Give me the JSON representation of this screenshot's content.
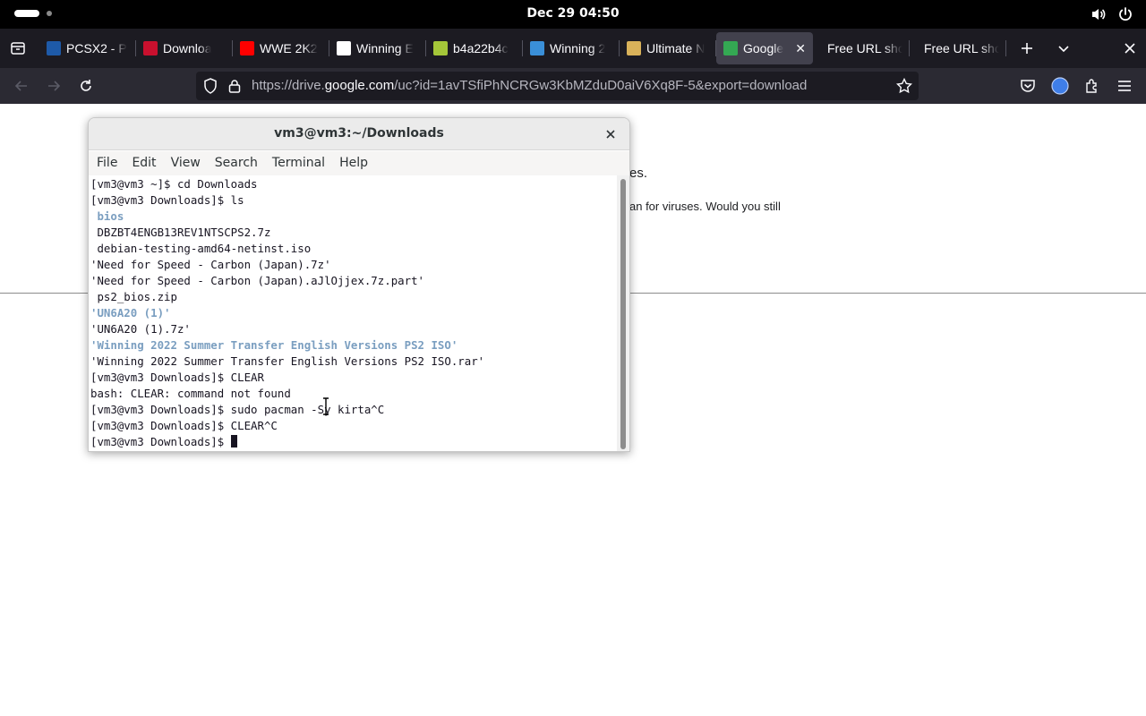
{
  "topbar": {
    "clock": "Dec 29  04:50",
    "icons": [
      "workspace-indicator-icon",
      "volume-icon",
      "power-icon"
    ]
  },
  "browser": {
    "tabs": [
      {
        "title": "PCSX2 - P",
        "favicon": "pcsx2-icon",
        "favicon_color": "#1e5aa8"
      },
      {
        "title": "Downloa",
        "favicon": "download-site-icon",
        "favicon_color": "#c8102e"
      },
      {
        "title": "WWE 2K2",
        "favicon": "youtube-icon",
        "favicon_color": "#ff0000"
      },
      {
        "title": "Winning E",
        "favicon": "winning-icon",
        "favicon_color": "#ffffff"
      },
      {
        "title": "b4a22b4c",
        "favicon": "android-icon",
        "favicon_color": "#a4c639"
      },
      {
        "title": "Winning 2",
        "favicon": "site-icon",
        "favicon_color": "#3a8fd8"
      },
      {
        "title": "Ultimate N",
        "favicon": "ultimate-icon",
        "favicon_color": "#d9b25a"
      },
      {
        "title": "Google",
        "favicon": "google-drive-icon",
        "favicon_color": "#34a853",
        "active": true
      },
      {
        "title": "Free URL sho",
        "favicon": ""
      },
      {
        "title": "Free URL sho",
        "favicon": ""
      }
    ],
    "url_prefix": "https://drive.",
    "url_domain": "google.com",
    "url_suffix": "/uc?id=1avTSfiPhNCRGw3KbMZduD0aiV6Xq8F-5&export=download"
  },
  "page": {
    "fragment_1": "es.",
    "fragment_2": "an for viruses. Would you still"
  },
  "terminal": {
    "title": "vm3@vm3:~/Downloads",
    "menu": [
      "File",
      "Edit",
      "View",
      "Search",
      "Terminal",
      "Help"
    ],
    "lines": [
      {
        "text": "[vm3@vm3 ~]$ cd Downloads",
        "kind": "plain"
      },
      {
        "text": "[vm3@vm3 Downloads]$ ls",
        "kind": "plain"
      },
      {
        "text": " bios",
        "kind": "dir"
      },
      {
        "text": " DBZBT4ENGB13REV1NTSCPS2.7z",
        "kind": "plain"
      },
      {
        "text": " debian-testing-amd64-netinst.iso",
        "kind": "plain"
      },
      {
        "text": "'Need for Speed - Carbon (Japan).7z'",
        "kind": "plain"
      },
      {
        "text": "'Need for Speed - Carbon (Japan).aJlOjjex.7z.part'",
        "kind": "plain"
      },
      {
        "text": " ps2_bios.zip",
        "kind": "plain"
      },
      {
        "text": "'UN6A20 (1)'",
        "kind": "dir"
      },
      {
        "text": "'UN6A20 (1).7z'",
        "kind": "plain"
      },
      {
        "text": "'Winning 2022 Summer Transfer English Versions PS2 ISO'",
        "kind": "dir"
      },
      {
        "text": "'Winning 2022 Summer Transfer English Versions PS2 ISO.rar'",
        "kind": "plain"
      },
      {
        "text": "[vm3@vm3 Downloads]$ CLEAR",
        "kind": "plain"
      },
      {
        "text": "bash: CLEAR: command not found",
        "kind": "plain"
      },
      {
        "text": "[vm3@vm3 Downloads]$ sudo pacman -Sy kirta^C",
        "kind": "plain"
      },
      {
        "text": "[vm3@vm3 Downloads]$ CLEAR^C",
        "kind": "plain"
      }
    ],
    "prompt": "[vm3@vm3 Downloads]$ "
  }
}
